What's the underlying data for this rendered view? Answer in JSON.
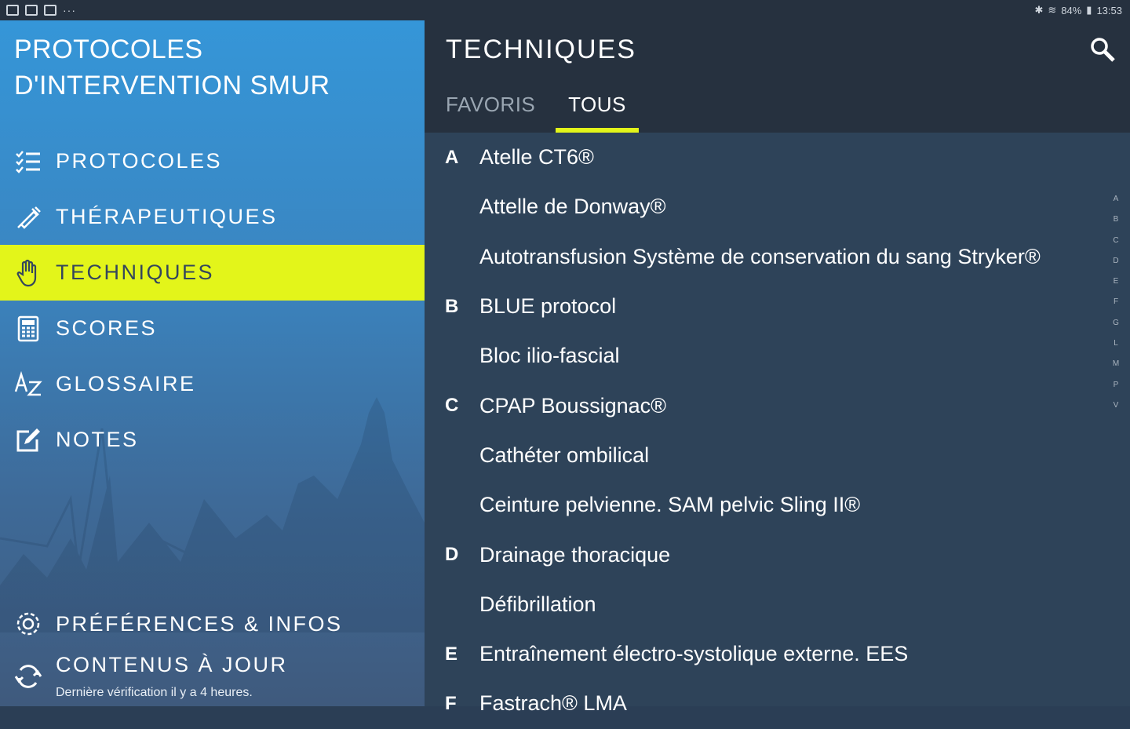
{
  "status_bar": {
    "time": "13:53",
    "battery": "84%"
  },
  "sidebar": {
    "app_title": "PROTOCOLES D'INTERVENTION SMUR",
    "items": [
      {
        "label": "PROTOCOLES",
        "icon": "checklist-icon"
      },
      {
        "label": "THÉRAPEUTIQUES",
        "icon": "syringe-icon"
      },
      {
        "label": "TECHNIQUES",
        "icon": "hand-icon",
        "active": true
      },
      {
        "label": "SCORES",
        "icon": "calculator-icon"
      },
      {
        "label": "GLOSSAIRE",
        "icon": "az-icon"
      },
      {
        "label": "NOTES",
        "icon": "edit-note-icon"
      }
    ],
    "preferences_label": "PRÉFÉRENCES & INFOS",
    "update_label": "CONTENUS À JOUR",
    "update_sub": "Dernière vérification il y a 4 heures."
  },
  "main": {
    "title": "TECHNIQUES",
    "tabs": [
      "FAVORIS",
      "TOUS"
    ],
    "active_tab": "TOUS",
    "list": [
      {
        "letter": "A",
        "name": "Atelle CT6®"
      },
      {
        "letter": "",
        "name": "Attelle de Donway®"
      },
      {
        "letter": "",
        "name": "Autotransfusion Système de conservation du sang Stryker®"
      },
      {
        "letter": "B",
        "name": "BLUE protocol"
      },
      {
        "letter": "",
        "name": "Bloc ilio-fascial"
      },
      {
        "letter": "C",
        "name": "CPAP Boussignac®"
      },
      {
        "letter": "",
        "name": "Cathéter ombilical"
      },
      {
        "letter": "",
        "name": "Ceinture pelvienne. SAM pelvic Sling II®"
      },
      {
        "letter": "D",
        "name": "Drainage thoracique"
      },
      {
        "letter": "",
        "name": "Défibrillation"
      },
      {
        "letter": "E",
        "name": "Entraînement électro-systolique externe. EES"
      },
      {
        "letter": "F",
        "name": "Fastrach® LMA"
      }
    ],
    "index_letters": [
      "A",
      "B",
      "C",
      "D",
      "E",
      "F",
      "G",
      "L",
      "M",
      "P",
      "V"
    ]
  },
  "colors": {
    "accent": "#e3f51a",
    "sidebar_top": "#3596d8",
    "main_bg": "#2e4359",
    "topbar": "#26313f"
  }
}
